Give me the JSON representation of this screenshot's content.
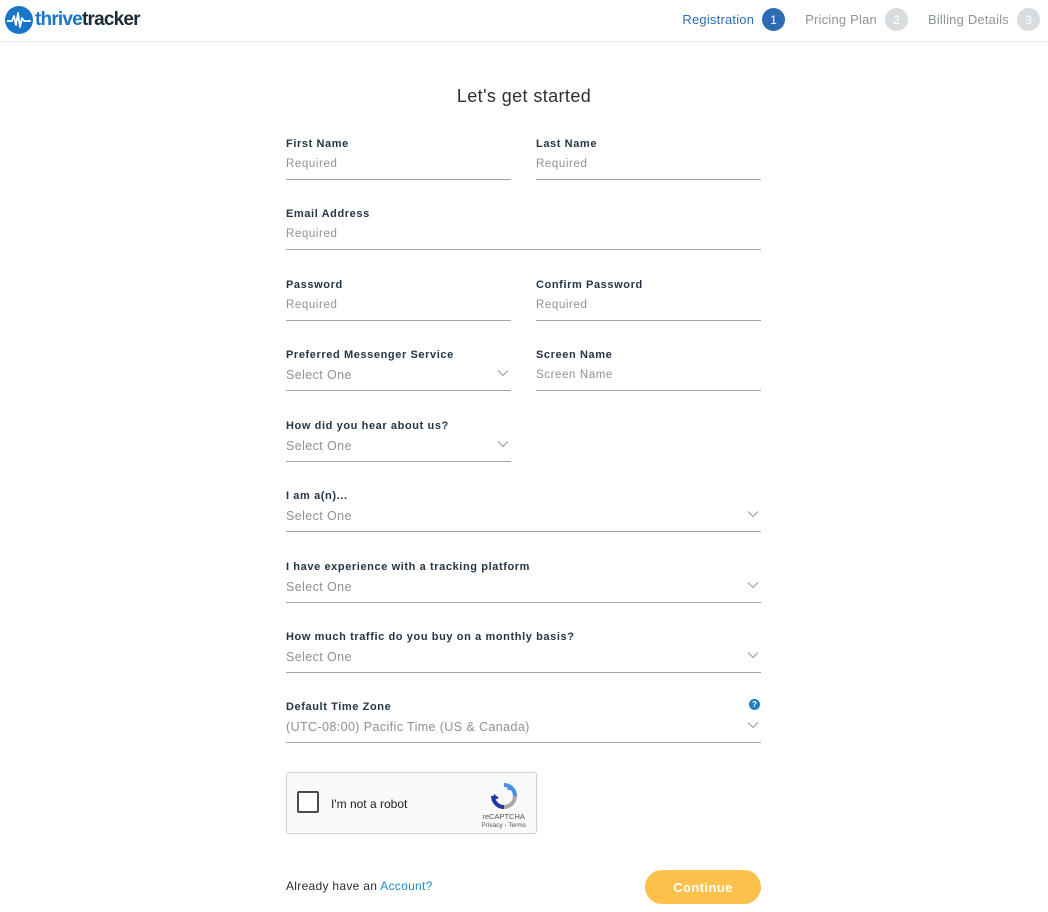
{
  "header": {
    "logo": {
      "part1": "thrive",
      "part2": "tracker",
      "icon": "heartbeat-circle-icon"
    },
    "steps": [
      {
        "label": "Registration",
        "num": "1",
        "active": true
      },
      {
        "label": "Pricing Plan",
        "num": "2",
        "active": false
      },
      {
        "label": "Billing Details",
        "num": "3",
        "active": false
      }
    ]
  },
  "form": {
    "title": "Let's get started",
    "first_name": {
      "label": "First Name",
      "placeholder": "Required"
    },
    "last_name": {
      "label": "Last Name",
      "placeholder": "Required"
    },
    "email": {
      "label": "Email Address",
      "placeholder": "Required"
    },
    "password": {
      "label": "Password",
      "placeholder": "Required"
    },
    "confirm_password": {
      "label": "Confirm Password",
      "placeholder": "Required"
    },
    "messenger": {
      "label": "Preferred Messenger Service",
      "value": "Select One"
    },
    "screen_name": {
      "label": "Screen Name",
      "placeholder": "Screen Name"
    },
    "hear_about": {
      "label": "How did you hear about us?",
      "value": "Select One"
    },
    "i_am": {
      "label": "I am a(n)...",
      "value": "Select One"
    },
    "experience": {
      "label": "I have experience with a tracking platform",
      "value": "Select One"
    },
    "traffic": {
      "label": "How much traffic do you buy on a monthly basis?",
      "value": "Select One"
    },
    "timezone": {
      "label": "Default Time Zone",
      "value": "(UTC-08:00) Pacific Time (US & Canada)",
      "help_icon": "question-icon"
    }
  },
  "captcha": {
    "label": "I'm not a robot",
    "brand": "reCAPTCHA",
    "privacy": "Privacy",
    "sep": " - ",
    "terms": "Terms"
  },
  "footer": {
    "prompt": "Already have an ",
    "link": "Account?",
    "continue": "Continue"
  },
  "colors": {
    "accent": "#2b6cb3",
    "button": "#fcc14a",
    "link": "#1d8ac7"
  }
}
